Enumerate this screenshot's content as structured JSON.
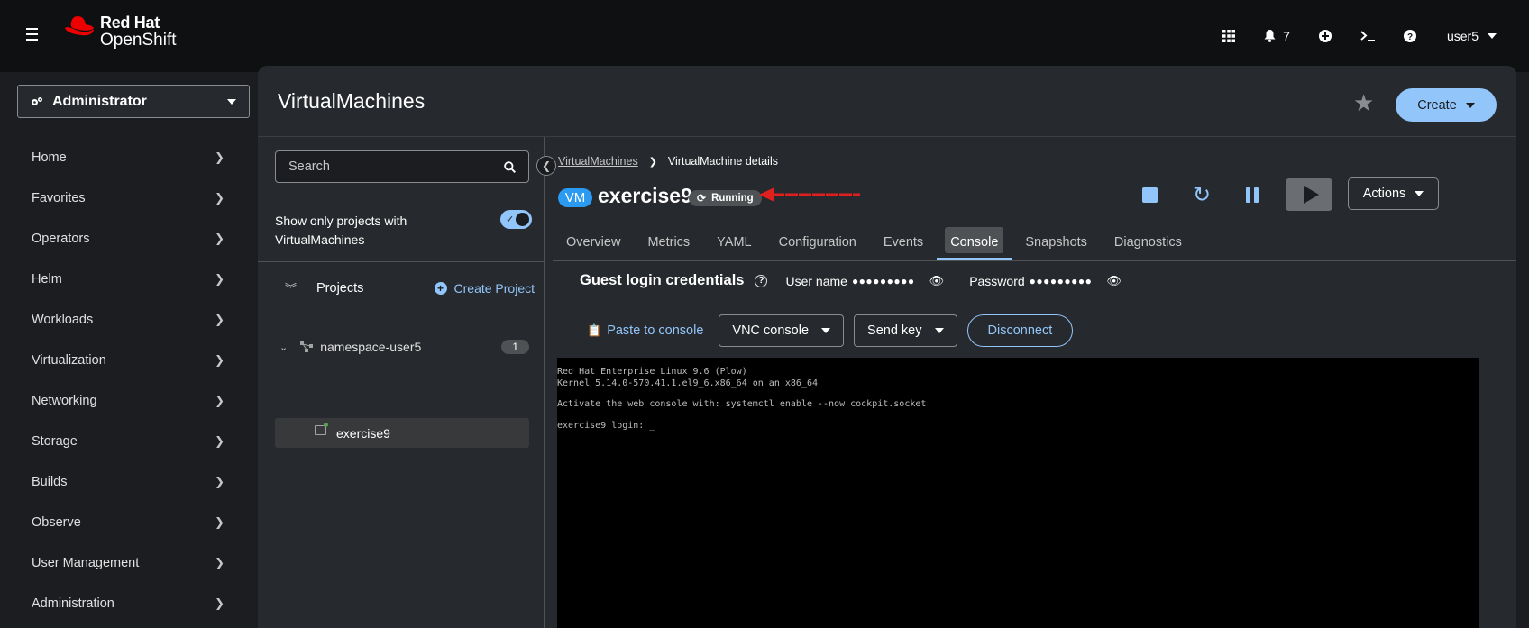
{
  "masthead": {
    "logo_line1": "Red Hat",
    "logo_line2": "OpenShift",
    "notifications_count": "7",
    "user": "user5",
    "icons": [
      "apps-grid-icon",
      "bell-icon",
      "plus-circle-icon",
      "terminal-icon",
      "help-icon"
    ]
  },
  "sidebar": {
    "perspective": "Administrator",
    "items": [
      {
        "label": "Home"
      },
      {
        "label": "Favorites"
      },
      {
        "label": "Operators"
      },
      {
        "label": "Helm"
      },
      {
        "label": "Workloads"
      },
      {
        "label": "Virtualization"
      },
      {
        "label": "Networking"
      },
      {
        "label": "Storage"
      },
      {
        "label": "Builds"
      },
      {
        "label": "Observe"
      },
      {
        "label": "User Management"
      },
      {
        "label": "Administration"
      }
    ]
  },
  "page": {
    "title": "VirtualMachines",
    "create_label": "Create"
  },
  "tree": {
    "search_placeholder": "Search",
    "toggle_label": "Show only projects with VirtualMachines",
    "toggle_on": true,
    "projects_label": "Projects",
    "create_project_label": "Create Project",
    "namespace": "namespace-user5",
    "namespace_count": "1",
    "vm": "exercise9"
  },
  "details": {
    "breadcrumb_link": "VirtualMachines",
    "breadcrumb_current": "VirtualMachine details",
    "vm_badge": "VM",
    "vm_name": "exercise9",
    "status": "Running",
    "actions_label": "Actions",
    "tabs": [
      {
        "label": "Overview"
      },
      {
        "label": "Metrics"
      },
      {
        "label": "YAML"
      },
      {
        "label": "Configuration"
      },
      {
        "label": "Events"
      },
      {
        "label": "Console",
        "active": true
      },
      {
        "label": "Snapshots"
      },
      {
        "label": "Diagnostics"
      }
    ],
    "creds_title": "Guest login credentials",
    "username_label": "User name",
    "username_mask": "●●●●●●●●●",
    "password_label": "Password",
    "password_mask": "●●●●●●●●●",
    "paste_label": "Paste to console",
    "console_type": "VNC console",
    "send_key": "Send key",
    "disconnect": "Disconnect",
    "console_lines": [
      "Red Hat Enterprise Linux 9.6 (Plow)",
      "Kernel 5.14.0-570.41.1.el9_6.x86_64 on an x86_64",
      "",
      "Activate the web console with: systemctl enable --now cockpit.socket",
      "",
      "exercise9 login: _"
    ]
  },
  "colors": {
    "accent": "#92c5f9",
    "vm_badge": "#2b9af3",
    "annotation_arrow": "#e0201f",
    "page_bg": "#26292d"
  }
}
